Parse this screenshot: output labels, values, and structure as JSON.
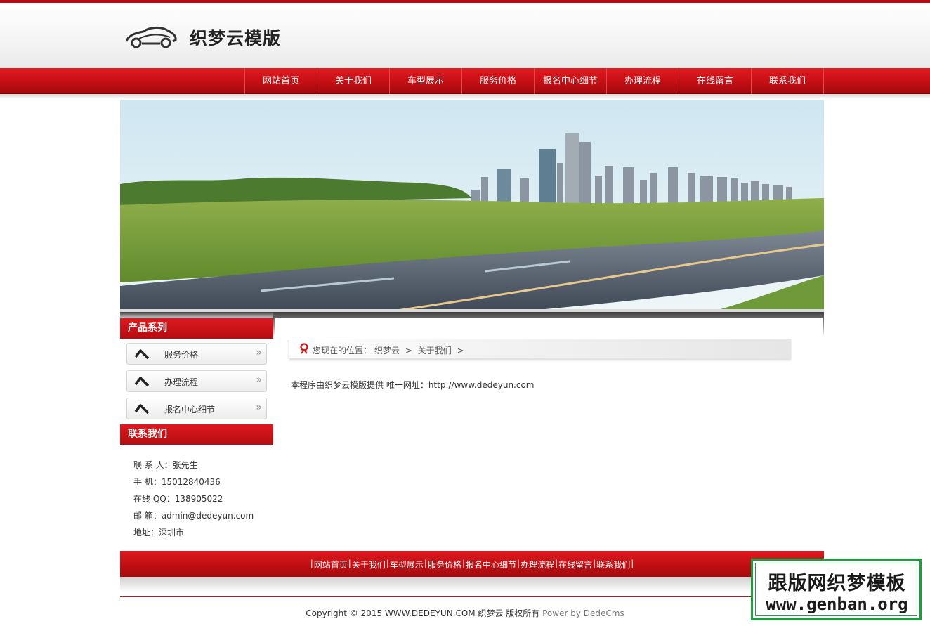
{
  "header": {
    "logo_text": "织梦云模版"
  },
  "nav": {
    "items": [
      "网站首页",
      "关于我们",
      "车型展示",
      "服务价格",
      "报名中心细节",
      "办理流程",
      "在线留言",
      "联系我们"
    ]
  },
  "sidebar": {
    "products_title": "产品系列",
    "products": [
      {
        "label": "服务价格",
        "chevron": "»"
      },
      {
        "label": "办理流程",
        "chevron": "»"
      },
      {
        "label": "报名中心细节",
        "chevron": "»"
      }
    ],
    "contact_title": "联系我们",
    "contact_lines": [
      "联 系 人：张先生",
      "手 机：15012840436",
      "在线 QQ：138905022",
      "邮 箱：admin@dedeyun.com",
      "地址：深圳市"
    ]
  },
  "breadcrumb": {
    "prefix": "您现在的位置：",
    "home": "织梦云",
    "sep": ">",
    "current": "关于我们",
    "trail": ">"
  },
  "content": {
    "text": "本程序由织梦云模版提供 唯一网址：http://www.dedeyun.com"
  },
  "footer": {
    "links": [
      "网站首页",
      "关于我们",
      "车型展示",
      "服务价格",
      "报名中心细节",
      "办理流程",
      "在线留言",
      "联系我们"
    ],
    "copyright": "Copyright © 2015 WWW.DEDEYUN.COM 织梦云 版权所有",
    "power": "Power by DedeCms"
  },
  "watermark": {
    "line1": "跟版网织梦模板",
    "line2": "www.genban.org"
  },
  "colors": {
    "brand_red": "#c40f14",
    "watermark_green": "#1e9c3f"
  },
  "icons": [
    "car-logo-icon",
    "arrow-icon",
    "chevron-right-icon",
    "location-pin-icon"
  ]
}
